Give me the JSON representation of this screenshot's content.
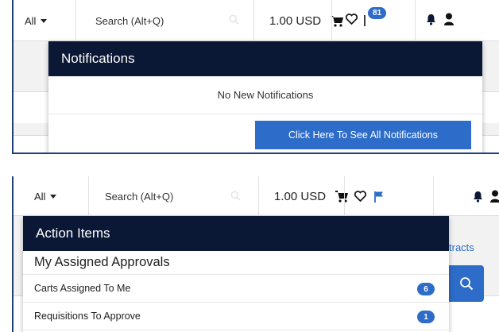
{
  "colors": {
    "primary": "#2d6cc8",
    "dropdown_header": "#0a1735"
  },
  "screenshot1": {
    "header": {
      "scope": "All",
      "search_placeholder": "Search (Alt+Q)",
      "currency": "1.00 USD",
      "action_count": "81"
    },
    "notifications": {
      "title": "Notifications",
      "empty_message": "No New Notifications",
      "see_all_label": "Click Here To See All Notifications"
    }
  },
  "screenshot2": {
    "header": {
      "scope": "All",
      "search_placeholder": "Search (Alt+Q)",
      "currency": "1.00 USD"
    },
    "action_items": {
      "title": "Action Items",
      "section": "My Assigned Approvals",
      "items": [
        {
          "label": "Carts Assigned To Me",
          "count": "6"
        },
        {
          "label": "Requisitions To Approve",
          "count": "1"
        }
      ]
    },
    "partial_link": "tracts"
  },
  "icons": [
    "caret-down-icon",
    "search-icon",
    "cart-icon",
    "heart-icon",
    "flag-icon",
    "bell-icon",
    "user-icon"
  ]
}
